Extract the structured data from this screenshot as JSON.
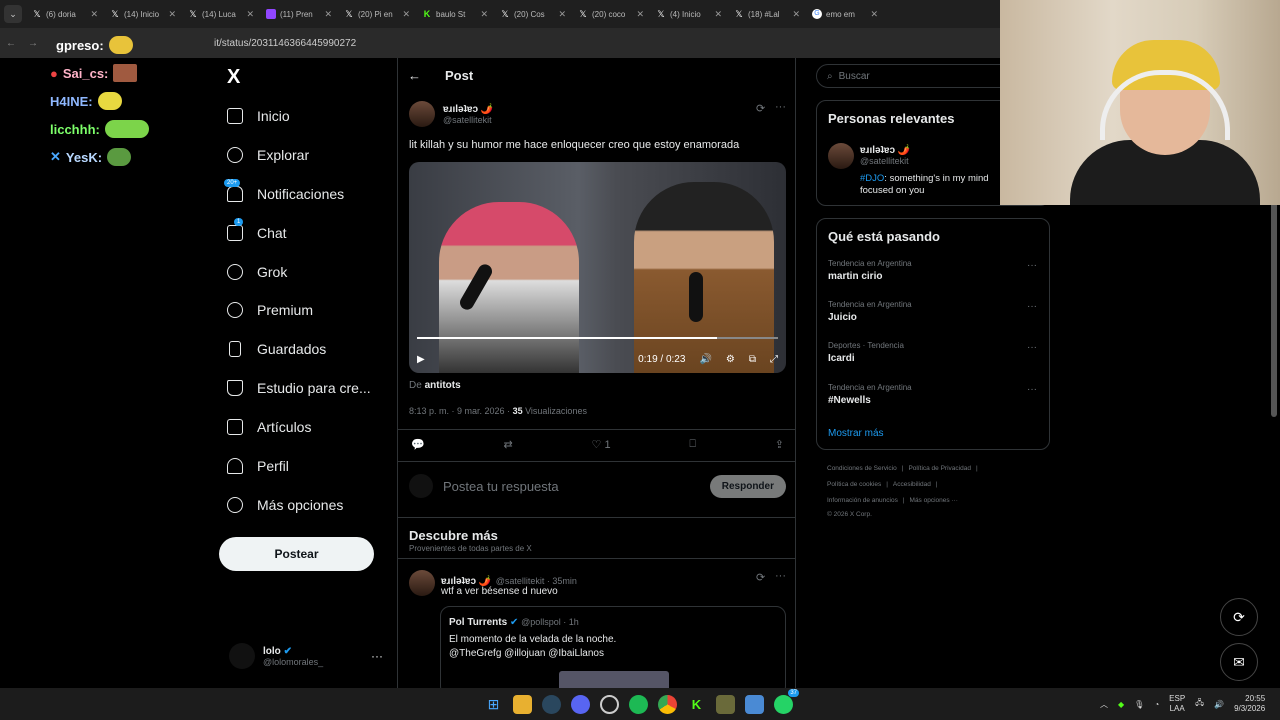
{
  "browser": {
    "tabs": [
      {
        "title": "(6) doria",
        "icon": "x-logo-icon"
      },
      {
        "title": "(14) Inicio",
        "icon": "x-logo-icon"
      },
      {
        "title": "(14) Luca",
        "icon": "x-logo-icon"
      },
      {
        "title": "(11) Pren",
        "icon": "twitch-icon"
      },
      {
        "title": "(20) Pi en",
        "icon": "x-logo-icon"
      },
      {
        "title": "baulo St",
        "icon": "kick-icon"
      },
      {
        "title": "(20) Cos",
        "icon": "x-logo-icon"
      },
      {
        "title": "(20) coco",
        "icon": "x-logo-icon"
      },
      {
        "title": "(4) Inicio",
        "icon": "x-logo-icon"
      },
      {
        "title": "(18) #Lal",
        "icon": "x-logo-icon"
      },
      {
        "title": "emo em",
        "icon": "google-icon"
      }
    ],
    "url": "it/status/2031146366445990272"
  },
  "stream_chat": [
    {
      "user": "gpreso:",
      "color": "#f0f0f0"
    },
    {
      "user": "Sai_cs:",
      "color": "#ffb3c8"
    },
    {
      "user": "H4INE:",
      "color": "#8fb8ff"
    },
    {
      "user": "licchhh:",
      "color": "#7dff6a"
    },
    {
      "user": "YesK:",
      "color": "#b8d8ff"
    }
  ],
  "stream_overlay_top": "YesK:",
  "sidebar": {
    "logo": "X",
    "items": [
      {
        "label": "Inicio",
        "icon": "home-icon"
      },
      {
        "label": "Explorar",
        "icon": "search-icon"
      },
      {
        "label": "Notificaciones",
        "icon": "bell-icon",
        "badge": "20+"
      },
      {
        "label": "Chat",
        "icon": "mail-icon",
        "badge": "1"
      },
      {
        "label": "Grok",
        "icon": "grok-icon"
      },
      {
        "label": "Premium",
        "icon": "verified-icon"
      },
      {
        "label": "Guardados",
        "icon": "bookmark-icon"
      },
      {
        "label": "Estudio para cre...",
        "icon": "flask-icon"
      },
      {
        "label": "Artículos",
        "icon": "article-icon"
      },
      {
        "label": "Perfil",
        "icon": "person-icon"
      },
      {
        "label": "Más opciones",
        "icon": "more-circle-icon"
      }
    ],
    "post_button": "Postear",
    "account": {
      "name": "lolo",
      "handle": "@lolomorales_",
      "more": "···"
    }
  },
  "post": {
    "header": "Post",
    "author_name": "ɐɹılǝʇɐɔ 🌶️",
    "author_handle": "@satellitekit",
    "text": "lit killah y su humor me hace enloquecer creo que estoy enamorada",
    "video": {
      "time": "0:19 / 0:23",
      "progress": 0.83
    },
    "source_prefix": "De ",
    "source": "antitots",
    "timestamp": "8:13 p. m. · 9 mar. 2026 · ",
    "views_count": "35",
    "views_label": " Visualizaciones",
    "likes": "1",
    "reply_placeholder": "Postea tu respuesta",
    "reply_button": "Responder"
  },
  "discover": {
    "title": "Descubre más",
    "subtitle": "Provenientes de todas partes de X",
    "tweet": {
      "author_name": "ɐɹılǝʇɐɔ 🌶️",
      "meta": "@satellitekit · 35min",
      "text": "wtf a ver bésense d nuevo",
      "quote_author": "Pol Turrents",
      "quote_meta": "@pollspol · 1h",
      "quote_text1": "El momento de la velada de la noche.",
      "quote_text2": "@TheGrefg @illojuan @IbaiLlanos"
    }
  },
  "right": {
    "search_placeholder": "Buscar",
    "relevant_title": "Personas relevantes",
    "relevant_name": "ɐɹılǝʇɐɔ 🌶️",
    "relevant_handle": "@satellitekit",
    "relevant_bio_tag": "#DJO",
    "relevant_bio": ": something's in my mind focused on you",
    "trending_title": "Qué está pasando",
    "trends": [
      {
        "context": "Tendencia en Argentina",
        "name": "martin cirio"
      },
      {
        "context": "Tendencia en Argentina",
        "name": "Juicio"
      },
      {
        "context": "Deportes · Tendencia",
        "name": "Icardi"
      },
      {
        "context": "Tendencia en Argentina",
        "name": "#Newells"
      }
    ],
    "show_more": "Mostrar más",
    "footer_row1": [
      "Condiciones de Servicio",
      "|",
      "Política de Privacidad",
      "|"
    ],
    "footer_row2": [
      "Política de cookies",
      "|",
      "Accesibilidad",
      "|"
    ],
    "footer_row3": [
      "Información de anuncios",
      "|",
      "Más opciones ···"
    ],
    "footer_row4": "© 2026 X Corp."
  },
  "taskbar": {
    "lang1": "ESP",
    "lang2": "LAA",
    "time": "20:55",
    "date": "9/3/2026",
    "whatsapp_badge": "37"
  }
}
